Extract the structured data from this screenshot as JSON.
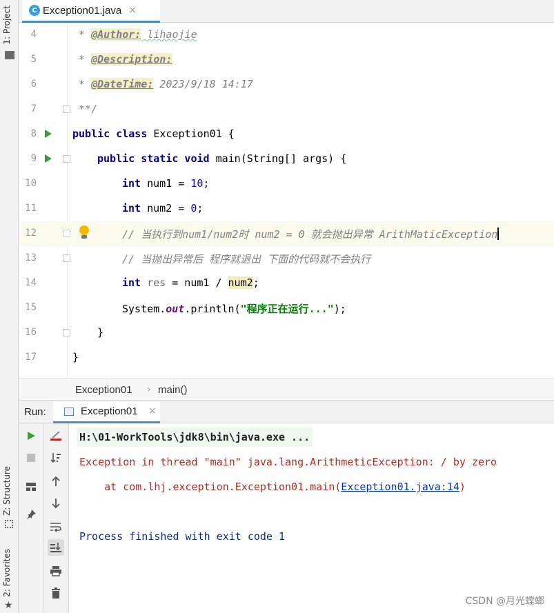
{
  "left_strip": {
    "project_tab": "1: Project",
    "structure_tab": "Z: Structure",
    "favorites_tab": "2: Favorites"
  },
  "editor_tab": {
    "icon": "java-class-icon",
    "icon_letter": "C",
    "title": "Exception01.java",
    "close": "×"
  },
  "code": {
    "line_numbers": [
      "4",
      "5",
      "6",
      "7",
      "8",
      "9",
      "10",
      "11",
      "12",
      "13",
      "14",
      "15",
      "16",
      "17"
    ],
    "l4": {
      "star": " * ",
      "tag": "@Author:",
      "value": " lihaojie"
    },
    "l5": {
      "star": " * ",
      "tag": "@Description:"
    },
    "l6": {
      "star": " * ",
      "tag": "@DateTime:",
      "value": " 2023/9/18 14:17"
    },
    "l7": {
      "text": " **/"
    },
    "l8": {
      "kw": "public class",
      "rest": " Exception01 {"
    },
    "l9": {
      "kw": "public static void",
      "rest": " main(String[] args) {"
    },
    "l10": {
      "kw": "int",
      "mid": " num1 = ",
      "num": "10",
      "end": ";"
    },
    "l11": {
      "kw": "int",
      "mid": " num2 = ",
      "num": "0",
      "end": ";"
    },
    "l12": {
      "text": "// 当执行到num1/num2时 num2 = 0 就会抛出异常 ArithMaticException"
    },
    "l13": {
      "text": "// 当抛出异常后 程序就退出 下面的代码就不会执行"
    },
    "l14": {
      "kw": "int",
      "var": " res",
      "mid": " = num1 / ",
      "hl": "num2",
      "end": ";"
    },
    "l15": {
      "pre": "System.",
      "field": "out",
      "mid": ".println(",
      "str": "\"程序正在运行...\"",
      "end": ");"
    },
    "l16": {
      "text": "}"
    },
    "l17": {
      "text": "}"
    }
  },
  "breadcrumb": {
    "class": "Exception01",
    "sep": "›",
    "method": "main()"
  },
  "run_panel": {
    "title": "Run:",
    "tab_label": "Exception01",
    "tab_close": "×",
    "console": {
      "cmd": "H:\\01-WorkTools\\jdk8\\bin\\java.exe ...",
      "exception": "Exception in thread \"main\" java.lang.ArithmeticException: / by zero",
      "at_prefix": "    at com.lhj.exception.Exception01.main(",
      "at_link": "Exception01.java:14",
      "at_suffix": ")",
      "finished": "Process finished with exit code 1"
    },
    "toolbar_left": [
      "run-icon",
      "stop-icon",
      "layout-icon",
      "pin-icon"
    ],
    "toolbar_right": [
      "clear-icon",
      "sort-down-icon",
      "up-arrow-icon",
      "down-arrow-icon",
      "soft-wrap-icon",
      "scroll-to-end-icon",
      "print-icon",
      "trash-icon"
    ]
  },
  "watermark": "CSDN @月光螳螂",
  "colors": {
    "keyword": "#000080",
    "number": "#0000ff",
    "comment": "#808080",
    "string": "#008000",
    "error": "#c0271c",
    "run_green": "#3c9a3c"
  }
}
